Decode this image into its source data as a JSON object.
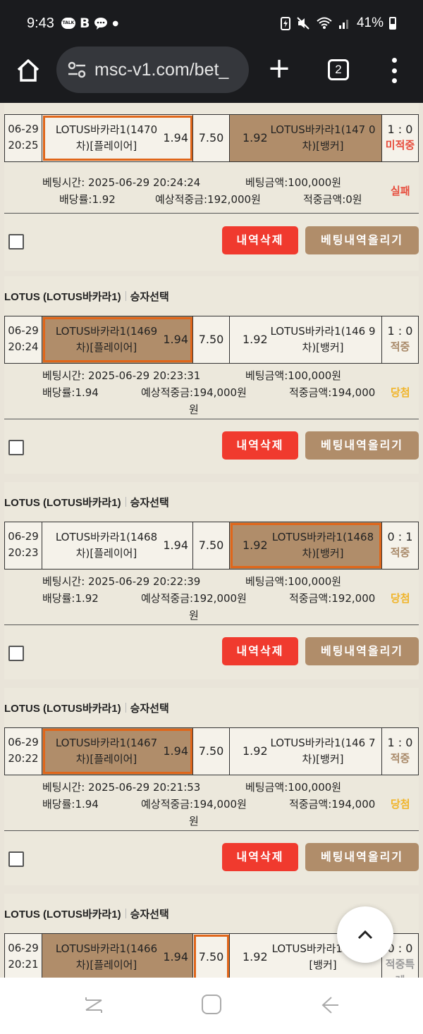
{
  "status_bar": {
    "time": "9:43",
    "talk_badge": "TALK",
    "b_icon": "B",
    "battery": "41%"
  },
  "browser": {
    "url": "msc-v1.com/bet_",
    "tab_count": "2"
  },
  "bets": [
    {
      "title": "",
      "subtitle": "",
      "date": "06-29",
      "time": "20:25",
      "player": "LOTUS바카라1(1470 차)[플레이어]",
      "player_odds": "1.94",
      "tie_odds": "7.50",
      "banker_odds": "1.92",
      "banker": "LOTUS바카라1(147 0 차)[뱅커]",
      "score": "1 : 0",
      "status": "미적중",
      "bet_time": "베팅시간: 2025-06-29 20:24:24",
      "bet_amount": "베팅금액:100,000원",
      "odds_line": "배당률:1.92",
      "expected": "예상적중금:192,000원",
      "hit_amount": "적중금액:0원",
      "expected_wrap": "",
      "result": "실패",
      "delete_label": "내역삭제",
      "upload_label": "베팅내역올리기"
    },
    {
      "title": "LOTUS (LOTUS바카라1)",
      "subtitle": "승자선택",
      "date": "06-29",
      "time": "20:24",
      "player": "LOTUS바카라1(1469 차)[플레이어]",
      "player_odds": "1.94",
      "tie_odds": "7.50",
      "banker_odds": "1.92",
      "banker": "LOTUS바카라1(146 9 차)[뱅커]",
      "score": "1 : 0",
      "status": "적중",
      "bet_time": "베팅시간: 2025-06-29 20:23:31",
      "bet_amount": "베팅금액:100,000원",
      "odds_line": "배당률:1.94",
      "expected": "예상적중금:194,000원",
      "hit_amount": "적중금액:194,000",
      "expected_wrap": "원",
      "result": "당첨",
      "delete_label": "내역삭제",
      "upload_label": "베팅내역올리기"
    },
    {
      "title": "LOTUS (LOTUS바카라1)",
      "subtitle": "승자선택",
      "date": "06-29",
      "time": "20:23",
      "player": "LOTUS바카라1(1468 차)[플레이어]",
      "player_odds": "1.94",
      "tie_odds": "7.50",
      "banker_odds": "1.92",
      "banker": "LOTUS바카라1(1468 차)[뱅커]",
      "score": "0 : 1",
      "status": "적중",
      "bet_time": "베팅시간: 2025-06-29 20:22:39",
      "bet_amount": "베팅금액:100,000원",
      "odds_line": "배당률:1.92",
      "expected": "예상적중금:192,000원",
      "hit_amount": "적중금액:192,000",
      "expected_wrap": "원",
      "result": "당첨",
      "delete_label": "내역삭제",
      "upload_label": "베팅내역올리기"
    },
    {
      "title": "LOTUS (LOTUS바카라1)",
      "subtitle": "승자선택",
      "date": "06-29",
      "time": "20:22",
      "player": "LOTUS바카라1(1467 차)[플레이어]",
      "player_odds": "1.94",
      "tie_odds": "7.50",
      "banker_odds": "1.92",
      "banker": "LOTUS바카라1(146 7 차)[뱅커]",
      "score": "1 : 0",
      "status": "적중",
      "bet_time": "베팅시간: 2025-06-29 20:21:53",
      "bet_amount": "베팅금액:100,000원",
      "odds_line": "배당률:1.94",
      "expected": "예상적중금:194,000원",
      "hit_amount": "적중금액:194,000",
      "expected_wrap": "원",
      "result": "당첨",
      "delete_label": "내역삭제",
      "upload_label": "베팅내역올리기"
    },
    {
      "title": "LOTUS (LOTUS바카라1)",
      "subtitle": "승자선택",
      "date": "06-29",
      "time": "20:21",
      "player": "LOTUS바카라1(1466 차)[플레이어]",
      "player_odds": "1.94",
      "tie_odds": "7.50",
      "banker_odds": "1.92",
      "banker": "LOTUS바카라1( 6 차)[뱅커]",
      "score": "0 : 0",
      "status": "적중특례"
    }
  ]
}
